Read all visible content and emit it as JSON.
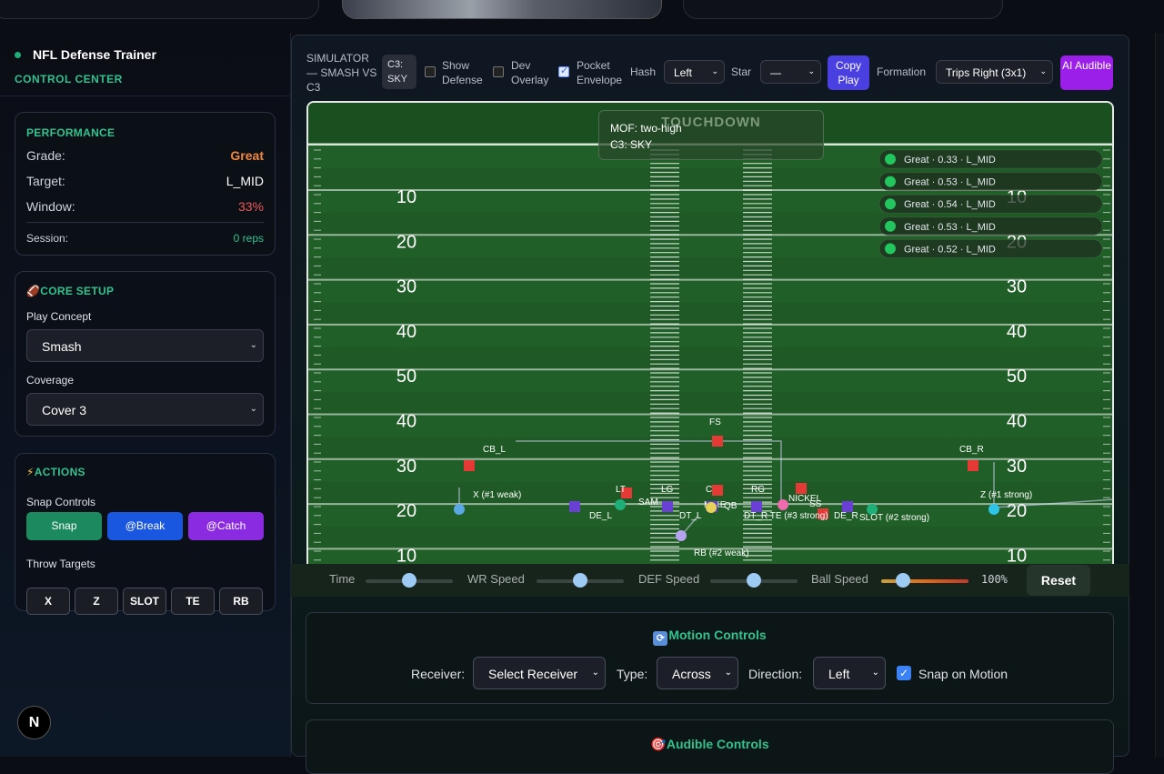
{
  "app": {
    "title": "NFL Defense Trainer",
    "subtitle": "CONTROL CENTER"
  },
  "performance": {
    "heading": "PERFORMANCE",
    "grade_label": "Grade:",
    "grade_value": "Great",
    "target_label": "Target:",
    "target_value": "L_MID",
    "window_label": "Window:",
    "window_value": "33%",
    "session_label": "Session:",
    "session_value": "0 reps"
  },
  "core_setup": {
    "heading": "CORE SETUP",
    "concept_label": "Play Concept",
    "concept_value": "Smash",
    "coverage_label": "Coverage",
    "coverage_value": "Cover 3"
  },
  "actions": {
    "heading": "ACTIONS",
    "snap_label": "Snap Controls",
    "snap_btn": "Snap",
    "break_btn": "@Break",
    "catch_btn": "@Catch",
    "throw_label": "Throw Targets",
    "targets": [
      "X",
      "Z",
      "SLOT",
      "TE",
      "RB"
    ]
  },
  "toolbar": {
    "sim_title": "SIMULATOR — SMASH VS C3",
    "c3_badge": "C3: SKY",
    "show_defense": "Show Defense",
    "dev_overlay": "Dev Overlay",
    "pocket_envelope": "Pocket Envelope",
    "hash_label": "Hash",
    "hash_value": "Left",
    "star_label": "Star",
    "star_value": "—",
    "copy_play": "Copy Play",
    "formation_label": "Formation",
    "formation_value": "Trips Right (3x1)",
    "ai_audible": "AI Audible",
    "show_defense_checked": false,
    "dev_overlay_checked": false,
    "pocket_checked": true
  },
  "field": {
    "endzone": "TOUCHDOWN",
    "mof": "MOF: two-high",
    "call": "C3: SKY",
    "yard_numbers": [
      "10",
      "20",
      "30",
      "40",
      "50",
      "40",
      "30",
      "20",
      "10"
    ],
    "feed": [
      "Great · 0.33 · L_MID",
      "Great · 0.53 · L_MID",
      "Great · 0.54 · L_MID",
      "Great · 0.53 · L_MID",
      "Great · 0.52 · L_MID"
    ],
    "labels": {
      "fs": "FS",
      "cb_l": "CB_L",
      "cb_r": "CB_R",
      "x": "X (#1 weak)",
      "z": "Z (#1 strong)",
      "lt": "LT",
      "lg": "LG",
      "c": "C",
      "rg": "RG",
      "sam": "SAM",
      "mike": "MIKE",
      "qb": "QB",
      "nickel": "NICKEL",
      "ss": "SS",
      "de_l": "DE_L",
      "dt_l": "DT_L",
      "dt_r": "DT_R",
      "te": "TE (#3 strong)",
      "de_r": "DE_R",
      "slot": "SLOT (#2 strong)",
      "rb": "RB (#2 weak)"
    },
    "colors": {
      "turf": "#1f5a26",
      "offense": "#5aa9e6",
      "defense": "#e53935",
      "line": "#6a3fd6",
      "pink": "#f06ab0",
      "green": "#1fb07a"
    }
  },
  "sliders": {
    "time": "Time",
    "wr": "WR Speed",
    "def": "DEF Speed",
    "ball": "Ball Speed",
    "ball_pct": "100%",
    "reset": "Reset",
    "time_level": 0.5,
    "wr_level": 0.5,
    "def_level": 0.5,
    "ball_level": 0.25
  },
  "motion": {
    "title": "Motion Controls",
    "receiver_label": "Receiver:",
    "receiver_value": "Select Receiver",
    "type_label": "Type:",
    "type_value": "Across",
    "direction_label": "Direction:",
    "direction_value": "Left",
    "snap_on_motion": "Snap on Motion",
    "snap_on_motion_checked": true
  },
  "audible": {
    "title": "Audible Controls"
  },
  "logo": "N"
}
